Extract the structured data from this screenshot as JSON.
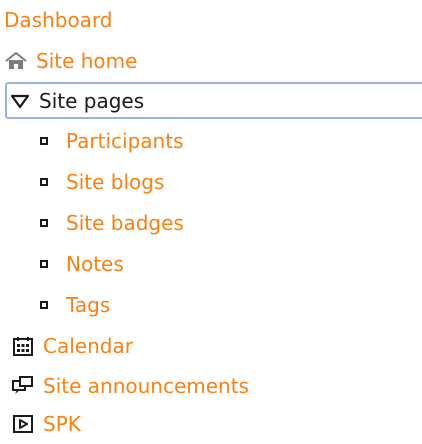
{
  "nav": {
    "dashboard": "Dashboard",
    "site_home": "Site home",
    "site_pages": "Site pages",
    "children": [
      "Participants",
      "Site blogs",
      "Site badges",
      "Notes",
      "Tags"
    ],
    "calendar": "Calendar",
    "site_announcements": "Site announcements",
    "spk": "SPK"
  },
  "icons": {
    "home": "home-icon",
    "site_pages_toggle": "chevron-down-triangle-icon",
    "calendar": "calendar-icon",
    "announcements": "chat-bubbles-icon",
    "spk": "play-box-icon"
  },
  "colors": {
    "link": "#f98012",
    "text": "#1a1a1a",
    "focus_border": "#9ab1da"
  }
}
